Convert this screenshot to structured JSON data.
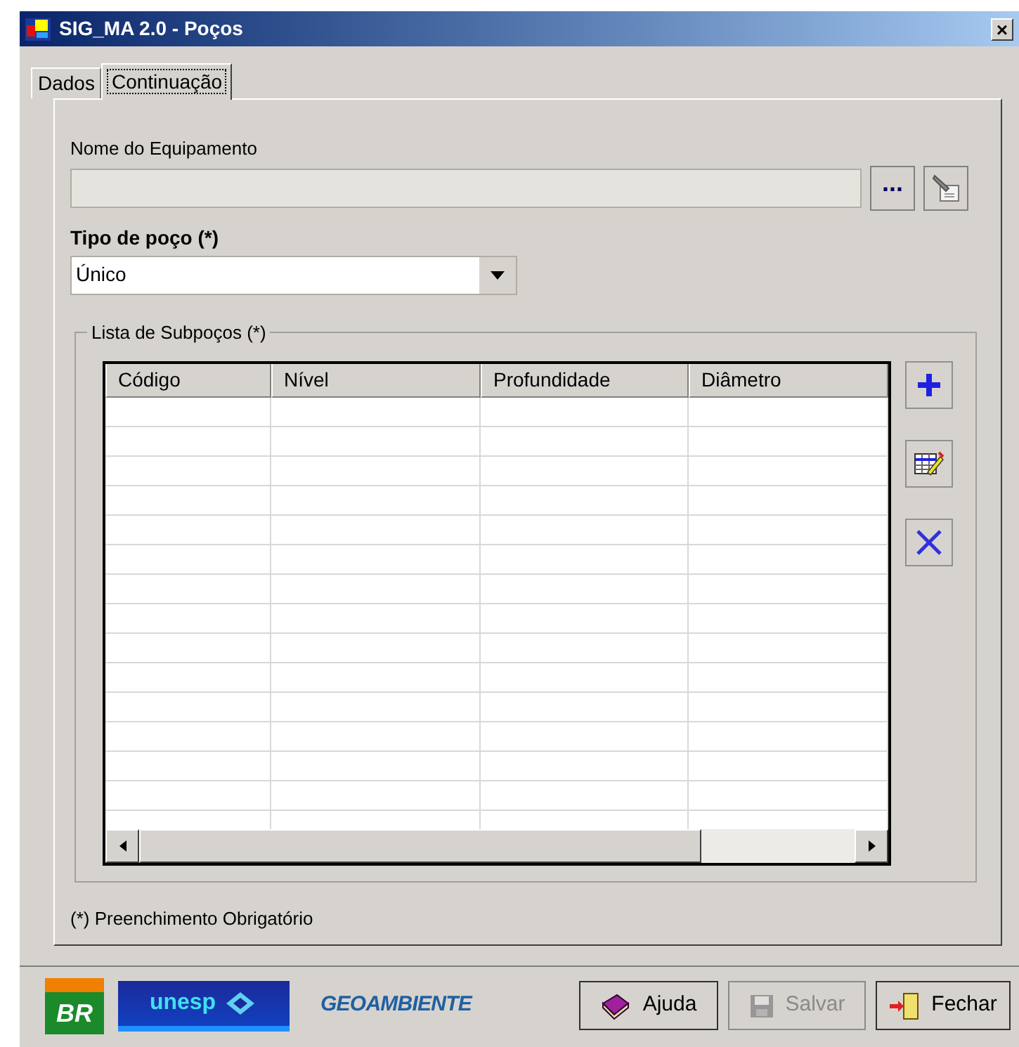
{
  "window": {
    "title": "SIG_MA 2.0 - Poços",
    "close": "×"
  },
  "tabs": [
    {
      "label": "Dados",
      "selected": false
    },
    {
      "label": "Continuação",
      "selected": true
    }
  ],
  "equipment": {
    "label": "Nome do Equipamento",
    "browse": "..."
  },
  "well_type": {
    "label": "Tipo de poço (*)",
    "value": "Único"
  },
  "subwells": {
    "title": "Lista de Subpoços (*)",
    "columns": [
      "Código",
      "Nível",
      "Profundidade",
      "Diâmetro"
    ]
  },
  "footnote": "(*) Preenchimento Obrigatório",
  "logos": [
    "BR",
    "unesp",
    "GEOAMBIENTE"
  ],
  "buttons": [
    {
      "label": "Ajuda",
      "kind": "help",
      "disabled": false
    },
    {
      "label": "Salvar",
      "kind": "save",
      "disabled": true
    },
    {
      "label": "Fechar",
      "kind": "close",
      "disabled": false
    }
  ]
}
